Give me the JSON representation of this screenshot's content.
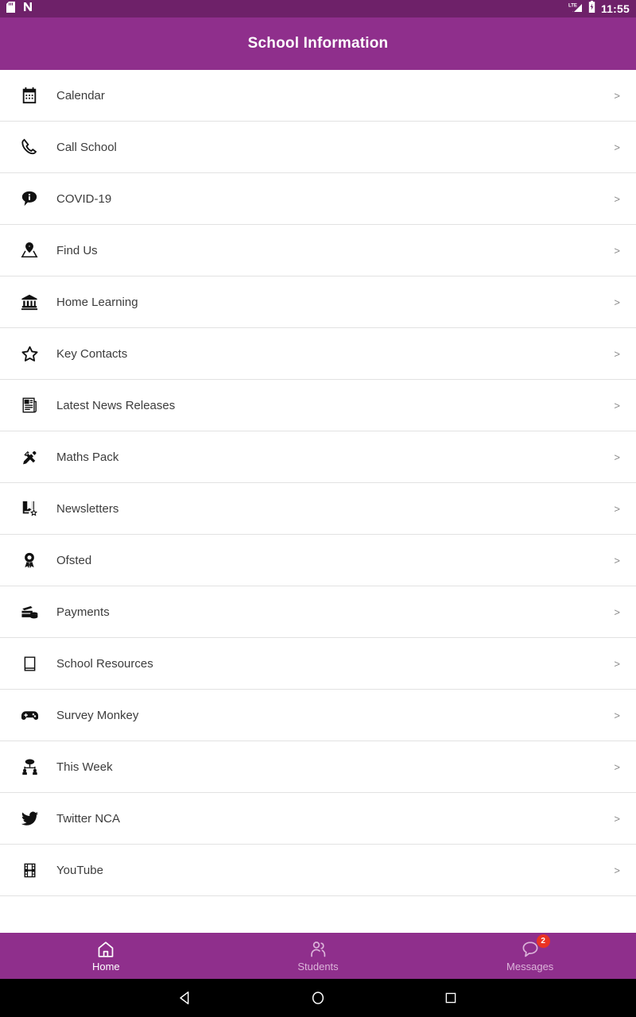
{
  "status_bar": {
    "left_icons": [
      "sd-card-icon",
      "nfc-n-icon"
    ],
    "right_icons": [
      "lte-signal-icon",
      "battery-charging-icon"
    ],
    "time": "11:55"
  },
  "header": {
    "title": "School Information",
    "background_color": "#8F2F8C"
  },
  "list": {
    "chevron": ">",
    "items": [
      {
        "label": "Calendar",
        "icon": "calendar-icon"
      },
      {
        "label": "Call School",
        "icon": "phone-icon"
      },
      {
        "label": "COVID-19",
        "icon": "info-bubble-icon"
      },
      {
        "label": "Find Us",
        "icon": "map-pin-icon"
      },
      {
        "label": "Home Learning",
        "icon": "bank-building-icon"
      },
      {
        "label": "Key Contacts",
        "icon": "star-icon"
      },
      {
        "label": "Latest News Releases",
        "icon": "newspaper-icon"
      },
      {
        "label": "Maths Pack",
        "icon": "ruler-pencil-icon"
      },
      {
        "label": "Newsletters",
        "icon": "book-star-icon"
      },
      {
        "label": "Ofsted",
        "icon": "award-rosette-icon"
      },
      {
        "label": "Payments",
        "icon": "credit-cards-icon"
      },
      {
        "label": "School Resources",
        "icon": "book-icon"
      },
      {
        "label": "Survey Monkey",
        "icon": "game-controller-icon"
      },
      {
        "label": "This Week",
        "icon": "people-group-icon"
      },
      {
        "label": "Twitter NCA",
        "icon": "twitter-bird-icon"
      },
      {
        "label": "YouTube",
        "icon": "film-strip-icon"
      }
    ]
  },
  "bottom_nav": {
    "background_color": "#8F2F8C",
    "badge_color": "#EA3323",
    "items": [
      {
        "label": "Home",
        "icon": "home-icon",
        "active": true,
        "badge": ""
      },
      {
        "label": "Students",
        "icon": "students-icon",
        "active": false,
        "badge": ""
      },
      {
        "label": "Messages",
        "icon": "message-icon",
        "active": false,
        "badge": "2"
      }
    ]
  },
  "android_nav": {
    "back": "back-triangle-icon",
    "home": "home-circle-icon",
    "recents": "recents-square-icon"
  }
}
